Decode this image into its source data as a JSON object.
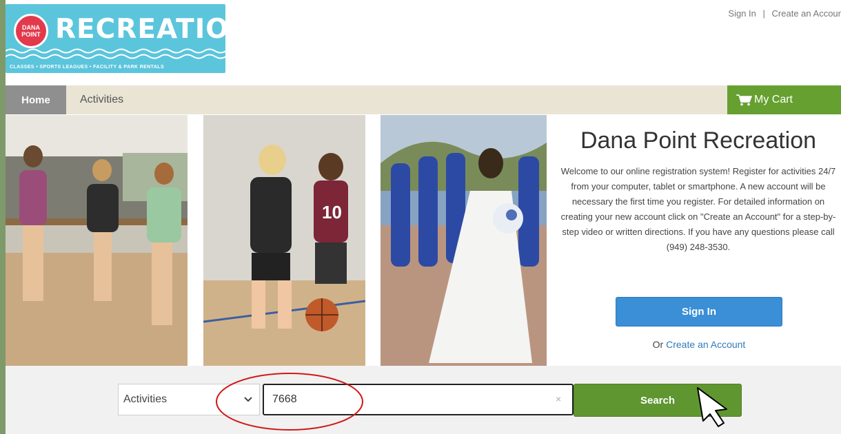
{
  "header": {
    "logo": {
      "badge_line1": "DANA",
      "badge_line2": "POINT",
      "wordmark": "RECREATION",
      "tagline": "CLASSES • SPORTS LEAGUES • FACILITY & PARK RENTALS"
    },
    "top_links": {
      "sign_in": "Sign In",
      "separator": "|",
      "create_account": "Create an Accour"
    }
  },
  "nav": {
    "home": "Home",
    "activities": "Activities",
    "cart": "My Cart"
  },
  "welcome": {
    "title": "Dana Point Recreation",
    "body": "Welcome to our online registration system! Register for activities 24/7 from your computer, tablet or smartphone. A new account will be necessary the first time you register. For detailed information on creating your new account click on \"Create an Account\" for a step-by-step video or written directions. If you have any questions please call (949) 248-3530.",
    "sign_in_button": "Sign In",
    "or_text": "Or",
    "create_account_link": "Create an Account"
  },
  "search": {
    "category_selected": "Activities",
    "query_value": "7668",
    "clear_symbol": "×",
    "button_label": "Search"
  },
  "colors": {
    "nav_bg": "#e9e4d4",
    "cart_green": "#66a030",
    "signin_blue": "#3a8fd6",
    "search_green": "#5f9630",
    "annotation_red": "#d01818",
    "logo_bg": "#5bc5dc"
  }
}
